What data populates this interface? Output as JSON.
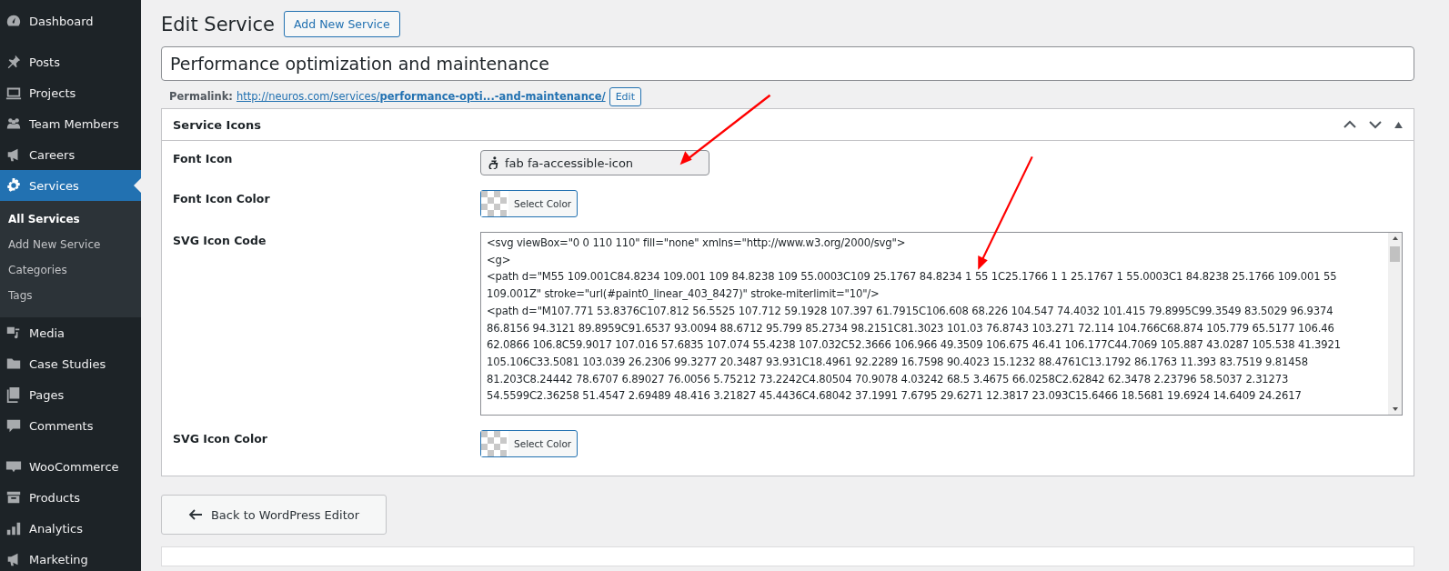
{
  "sidebar": {
    "groups": [
      [
        {
          "label": "Dashboard",
          "selected": false
        }
      ],
      [
        {
          "label": "Posts",
          "selected": false
        },
        {
          "label": "Projects",
          "selected": false
        },
        {
          "label": "Team Members",
          "selected": false
        },
        {
          "label": "Careers",
          "selected": false
        },
        {
          "label": "Services",
          "selected": true,
          "children": [
            {
              "label": "All Services",
              "selected": true
            },
            {
              "label": "Add New Service",
              "selected": false
            },
            {
              "label": "Categories",
              "selected": false
            },
            {
              "label": "Tags",
              "selected": false
            }
          ]
        },
        {
          "label": "Media",
          "selected": false
        },
        {
          "label": "Case Studies",
          "selected": false
        },
        {
          "label": "Pages",
          "selected": false
        },
        {
          "label": "Comments",
          "selected": false
        }
      ],
      [
        {
          "label": "WooCommerce",
          "selected": false
        },
        {
          "label": "Products",
          "selected": false
        },
        {
          "label": "Analytics",
          "selected": false
        },
        {
          "label": "Marketing",
          "selected": false
        }
      ]
    ]
  },
  "page": {
    "heading": "Edit Service",
    "add_button": "Add New Service",
    "title_value": "Performance optimization and maintenance",
    "permalink": {
      "label": "Permalink:",
      "url_base": "http://neuros.com/services/",
      "url_slug": "performance-opti...-and-maintenance/",
      "edit_button": "Edit"
    }
  },
  "metabox": {
    "title": "Service Icons",
    "fields": [
      {
        "kind": "icon",
        "label": "Font Icon",
        "value": "fab fa-accessible-icon"
      },
      {
        "kind": "color",
        "label": "Font Icon Color",
        "button": "Select Color"
      },
      {
        "kind": "code",
        "label": "SVG Icon Code",
        "lines": [
          "<svg viewBox=\"0 0 110 110\" fill=\"none\" xmlns=\"http://www.w3.org/2000/svg\">",
          "<g>",
          "<path d=\"M55 109.001C84.8234 109.001 109 84.8238 109 55.0003C109 25.1767 84.8234 1 55 1C25.1766 1 1 25.1767 1 55.0003C1 84.8238 25.1766 109.001 55",
          "109.001Z\" stroke=\"url(#paint0_linear_403_8427)\" stroke-miterlimit=\"10\"/>",
          "<path d=\"M107.771 53.8376C107.812 56.5525 107.712 59.1928 107.397 61.7915C106.608 68.226 104.547 74.4032 101.415 79.8995C99.3549 83.5029 96.9374",
          "86.8156 94.3121 89.8959C91.6537 93.0094 88.6712 95.799 85.2734 98.2151C81.3023 101.03 76.8743 103.271 72.114 104.766C68.874 105.779 65.5177 106.46",
          "62.0866 106.8C59.9017 107.016 57.6835 107.074 55.4238 107.032C52.3666 106.966 49.3509 106.675 46.41 106.177C44.7069 105.887 43.0287 105.538 41.3921",
          "105.106C33.5081 103.039 26.2306 99.3277 20.3487 93.931C18.4961 92.2289 16.7598 90.4023 15.1232 88.4761C13.1792 86.1763 11.393 83.7519 9.81458",
          "81.203C8.24442 78.6707 6.89027 76.0056 5.75212 73.2242C4.80504 70.9078 4.03242 68.5 3.4675 66.0258C2.62842 62.3478 2.23796 58.5037 2.31273",
          "54.5599C2.36258 51.4547 2.69489 48.416 3.21827 45.4436C4.68042 37.1991 7.6795 29.6271 12.3817 23.093C15.6466 18.5681 19.6924 14.6409 24.2617"
        ]
      },
      {
        "kind": "color",
        "label": "SVG Icon Color",
        "button": "Select Color"
      }
    ]
  },
  "back_button": "Back to WordPress Editor"
}
